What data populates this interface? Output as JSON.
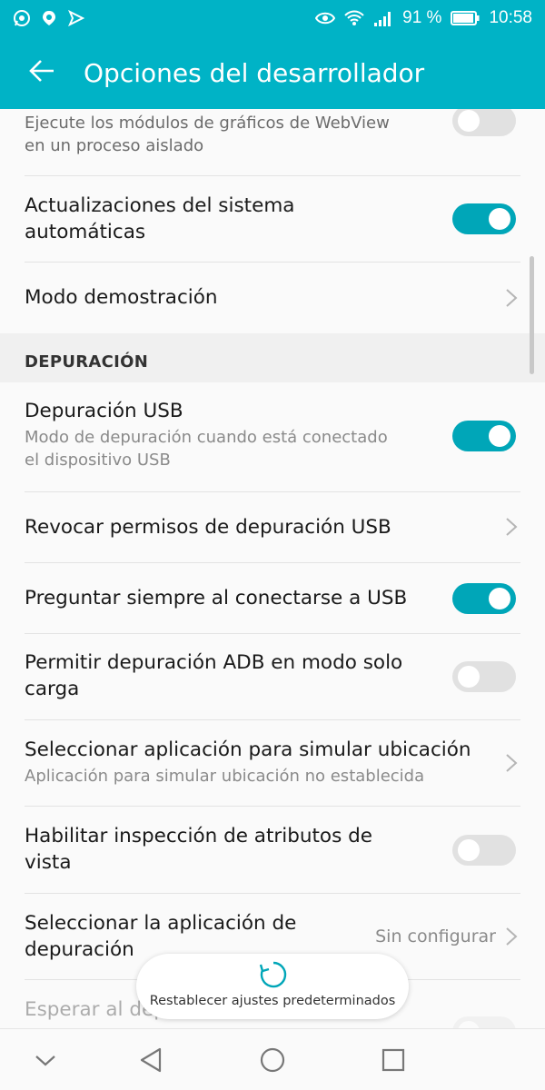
{
  "status_bar": {
    "left_icons": [
      "whatsapp-icon",
      "location-pin-icon",
      "messaging-icon"
    ],
    "right_icons": [
      "eye-icon",
      "wifi-icon",
      "signal-icon"
    ],
    "battery_percent": "91 %",
    "time": "10:58"
  },
  "app_bar": {
    "back_icon": "arrow-left-icon",
    "title": "Opciones del desarrollador"
  },
  "settings": {
    "webview": {
      "title": "Ejecute los módulos de gráficos de WebView",
      "subtitle": "en un proceso aislado",
      "toggle": false
    },
    "auto_updates": {
      "title_line1": "Actualizaciones del sistema",
      "title_line2": "automáticas",
      "toggle": true
    },
    "demo_mode": {
      "title": "Modo demostración"
    },
    "section_debug": "DEPURACIÓN",
    "usb_debug": {
      "title": "Depuración USB",
      "subtitle_line1": "Modo de depuración cuando está conectado",
      "subtitle_line2": "el dispositivo USB",
      "toggle": true
    },
    "revoke_usb": {
      "title": "Revocar permisos de depuración USB"
    },
    "ask_usb": {
      "title": "Preguntar siempre al conectarse a USB",
      "toggle": true
    },
    "adb_charge": {
      "title_line1": "Permitir depuración ADB en modo solo",
      "title_line2": "carga",
      "toggle": false
    },
    "mock_location": {
      "title": "Seleccionar aplicación para simular ubicación",
      "subtitle": "Aplicación para simular ubicación no establecida"
    },
    "view_attr": {
      "title_line1": "Habilitar inspección de atributos de",
      "title_line2": "vista",
      "toggle": false
    },
    "debug_app": {
      "title_line1": "Seleccionar la aplicación de",
      "title_line2": "depuración",
      "value": "Sin configurar"
    },
    "wait_debugger": {
      "title": "Esperar al depurador"
    }
  },
  "toast": {
    "icon": "refresh-icon",
    "label": "Restablecer ajustes predeterminados"
  },
  "nav_bar": {
    "icons": [
      "chevron-down-icon",
      "back-triangle-icon",
      "home-circle-icon",
      "recents-square-icon"
    ]
  },
  "colors": {
    "accent": "#00b3c6",
    "toggle_on": "#00a6b8",
    "toggle_off": "#e1e1e1"
  }
}
